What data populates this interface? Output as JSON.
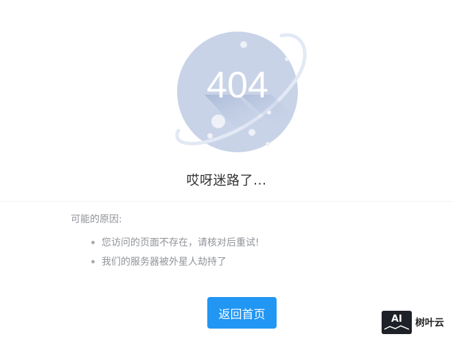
{
  "error": {
    "code": "404",
    "headline": "哎呀迷路了...",
    "colors": {
      "planet": "#c8d3e8",
      "ring": "#e3e9f4",
      "code_text": "#ffffff",
      "accent": "#2196f3"
    }
  },
  "reasons": {
    "title": "可能的原因:",
    "items": [
      {
        "text": "您访问的页面不存在，请核对后重试!"
      },
      {
        "text": "我们的服务器被外星人劫持了"
      }
    ]
  },
  "actions": {
    "home_label": "返回首页"
  },
  "watermark": {
    "logo_text": "AI",
    "brand": "树叶云"
  }
}
